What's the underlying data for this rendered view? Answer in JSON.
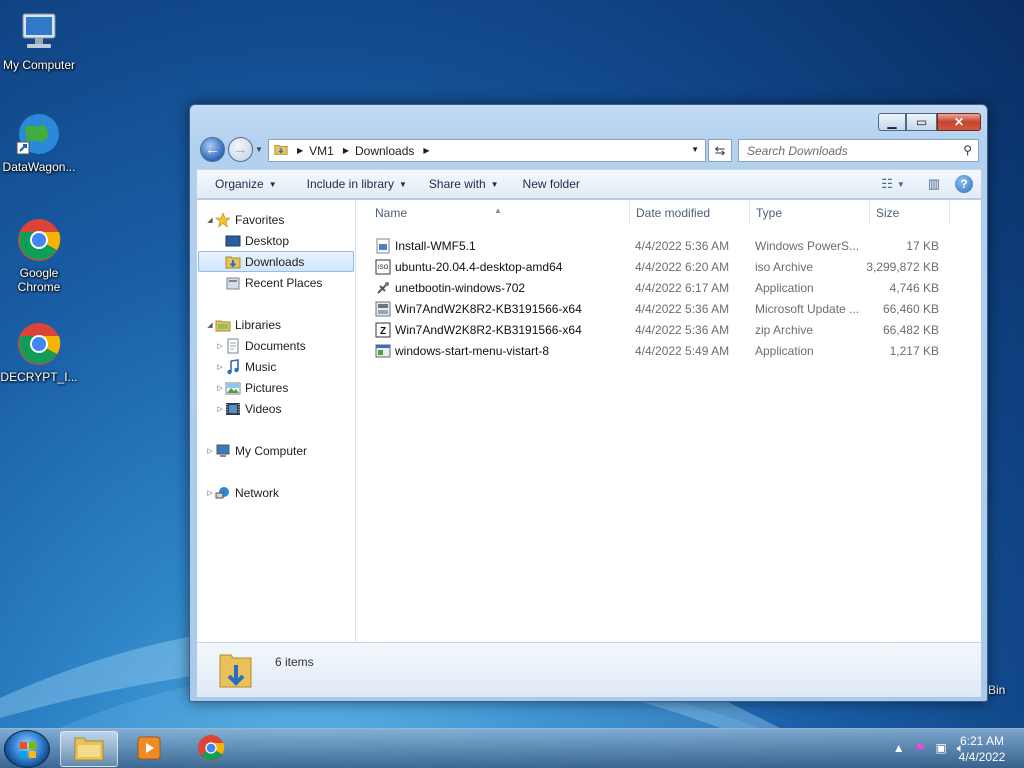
{
  "desktop": {
    "icons": [
      {
        "label": "My Computer",
        "icon": "computer-icon"
      },
      {
        "label": "DataWagon...",
        "icon": "globe-shortcut-icon"
      },
      {
        "label": "Google Chrome",
        "icon": "chrome-icon"
      },
      {
        "label": "DECRYPT_I...",
        "icon": "chrome-icon"
      }
    ],
    "recycle_partial_label": "Bin"
  },
  "window": {
    "address": {
      "crumbs": [
        "VM1",
        "Downloads"
      ]
    },
    "search_placeholder": "Search Downloads",
    "toolbar": {
      "organize": "Organize",
      "include_in_library": "Include in library",
      "share_with": "Share with",
      "new_folder": "New folder"
    },
    "nav": {
      "favorites": "Favorites",
      "desktop": "Desktop",
      "downloads": "Downloads",
      "recent_places": "Recent Places",
      "libraries": "Libraries",
      "documents": "Documents",
      "music": "Music",
      "pictures": "Pictures",
      "videos": "Videos",
      "my_computer": "My Computer",
      "network": "Network"
    },
    "columns": {
      "name": "Name",
      "date": "Date modified",
      "type": "Type",
      "size": "Size"
    },
    "files": [
      {
        "name": "Install-WMF5.1",
        "date": "4/4/2022 5:36 AM",
        "type": "Windows PowerS...",
        "size": "17 KB",
        "icon": "powershell-script-icon"
      },
      {
        "name": "ubuntu-20.04.4-desktop-amd64",
        "date": "4/4/2022 6:20 AM",
        "type": "iso Archive",
        "size": "3,299,872 KB",
        "icon": "iso-icon"
      },
      {
        "name": "unetbootin-windows-702",
        "date": "4/4/2022 6:17 AM",
        "type": "Application",
        "size": "4,746 KB",
        "icon": "unetbootin-icon"
      },
      {
        "name": "Win7AndW2K8R2-KB3191566-x64",
        "date": "4/4/2022 5:36 AM",
        "type": "Microsoft Update ...",
        "size": "66,460 KB",
        "icon": "msu-icon"
      },
      {
        "name": "Win7AndW2K8R2-KB3191566-x64",
        "date": "4/4/2022 5:36 AM",
        "type": "zip Archive",
        "size": "66,482 KB",
        "icon": "zip-icon"
      },
      {
        "name": "windows-start-menu-vistart-8",
        "date": "4/4/2022 5:49 AM",
        "type": "Application",
        "size": "1,217 KB",
        "icon": "app-icon"
      }
    ],
    "status": {
      "item_count": "6 items"
    }
  },
  "taskbar": {
    "clock_time": "6:21 AM",
    "clock_date": "4/4/2022"
  }
}
